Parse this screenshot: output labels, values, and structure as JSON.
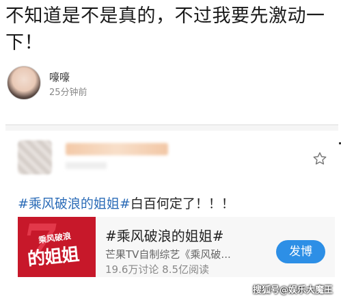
{
  "headline": "不知道是不是真的，不过我要先激动一下！",
  "author": {
    "name": "嚎嚎",
    "time": "25分钟前"
  },
  "post": {
    "hashtag": "#乘风破浪的姐姐#",
    "text_rest": "白百何定了！！！"
  },
  "share_card": {
    "thumb_small": "乘风破浪",
    "thumb_big": "的姐姐",
    "title": "#乘风破浪的姐姐#",
    "subtitle": "芒果TV自制综艺《乘风破...",
    "stats": "19.6万讨论   8.5亿阅读",
    "button": "发博"
  },
  "watermark": "搜狐号@娱乐大魔王",
  "colors": {
    "link": "#2a6bb7",
    "button": "#2d8fe6",
    "thumb_bg": "#c7182a"
  }
}
